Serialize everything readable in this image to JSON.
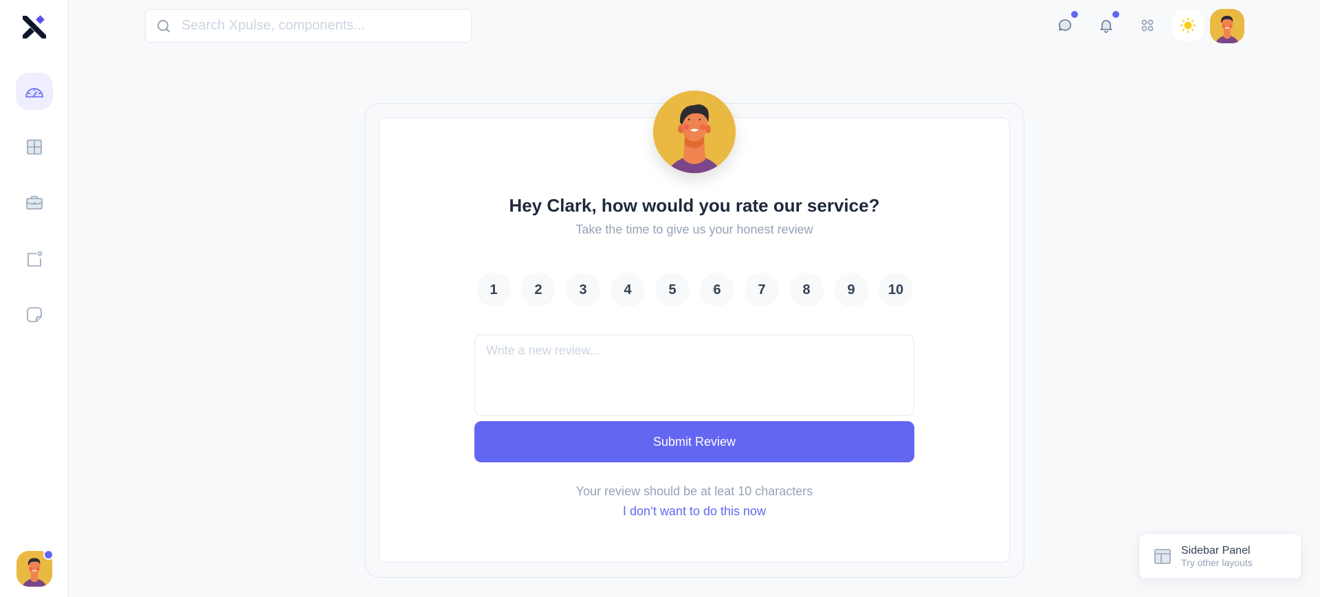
{
  "app": {
    "brand_icon": "x-logo-icon",
    "accent_color": "#6366f1"
  },
  "sidebar": {
    "items": [
      {
        "name": "dashboard",
        "icon": "gauge-icon",
        "active": true
      },
      {
        "name": "layouts",
        "icon": "grid-icon",
        "active": false
      },
      {
        "name": "projects",
        "icon": "briefcase-icon",
        "active": false
      },
      {
        "name": "notifications",
        "icon": "square-dot-icon",
        "active": false
      },
      {
        "name": "notes",
        "icon": "sticky-note-icon",
        "active": false
      }
    ],
    "user_avatar_has_status": true
  },
  "header": {
    "search": {
      "placeholder": "Search Xpulse, components...",
      "value": ""
    },
    "icons": [
      {
        "name": "messages",
        "icon": "chat-bubble-icon",
        "has_badge": true
      },
      {
        "name": "notifications",
        "icon": "bell-icon",
        "has_badge": true
      },
      {
        "name": "apps",
        "icon": "apps-grid-icon",
        "has_badge": false
      },
      {
        "name": "theme",
        "icon": "sun-icon",
        "has_badge": false
      }
    ]
  },
  "review": {
    "title": "Hey Clark, how would you rate our service?",
    "subtitle": "Take the time to give us your honest review",
    "ratings": [
      "1",
      "2",
      "3",
      "4",
      "5",
      "6",
      "7",
      "8",
      "9",
      "10"
    ],
    "textarea": {
      "placeholder": "Write a new review...",
      "value": ""
    },
    "submit_label": "Submit Review",
    "hint": "Your review should be at leat 10 characters",
    "skip_label": "I don‘t want to do this now"
  },
  "panel_widget": {
    "title": "Sidebar Panel",
    "subtitle": "Try other layouts"
  }
}
